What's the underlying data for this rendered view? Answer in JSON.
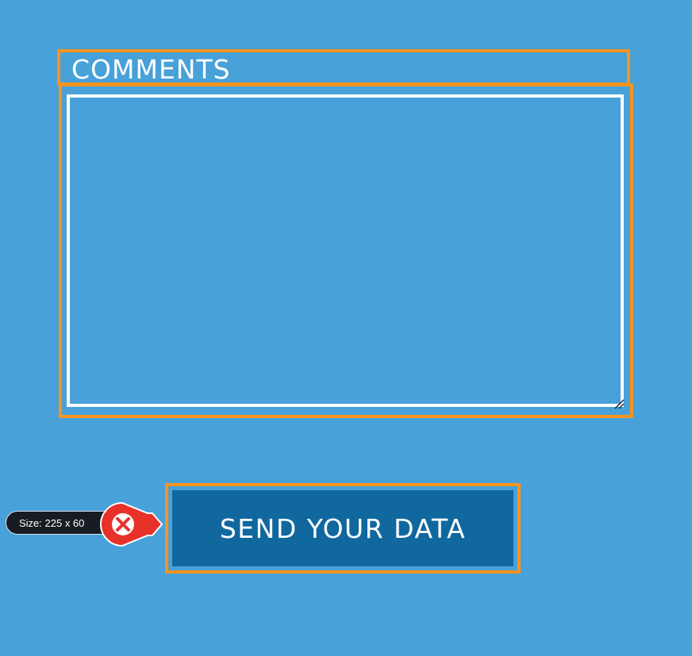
{
  "form": {
    "comments_label": "COMMENTS",
    "comments_value": "",
    "submit_label": "SEND YOUR DATA"
  },
  "overlay": {
    "size_text": "Size: 225 x 60",
    "close_icon": "close-x-icon"
  },
  "colors": {
    "background": "#48a1d9",
    "highlight_outline": "#f7941d",
    "button_fill": "#10689f",
    "close_red": "#e8312a",
    "badge_dark": "#161c22"
  }
}
